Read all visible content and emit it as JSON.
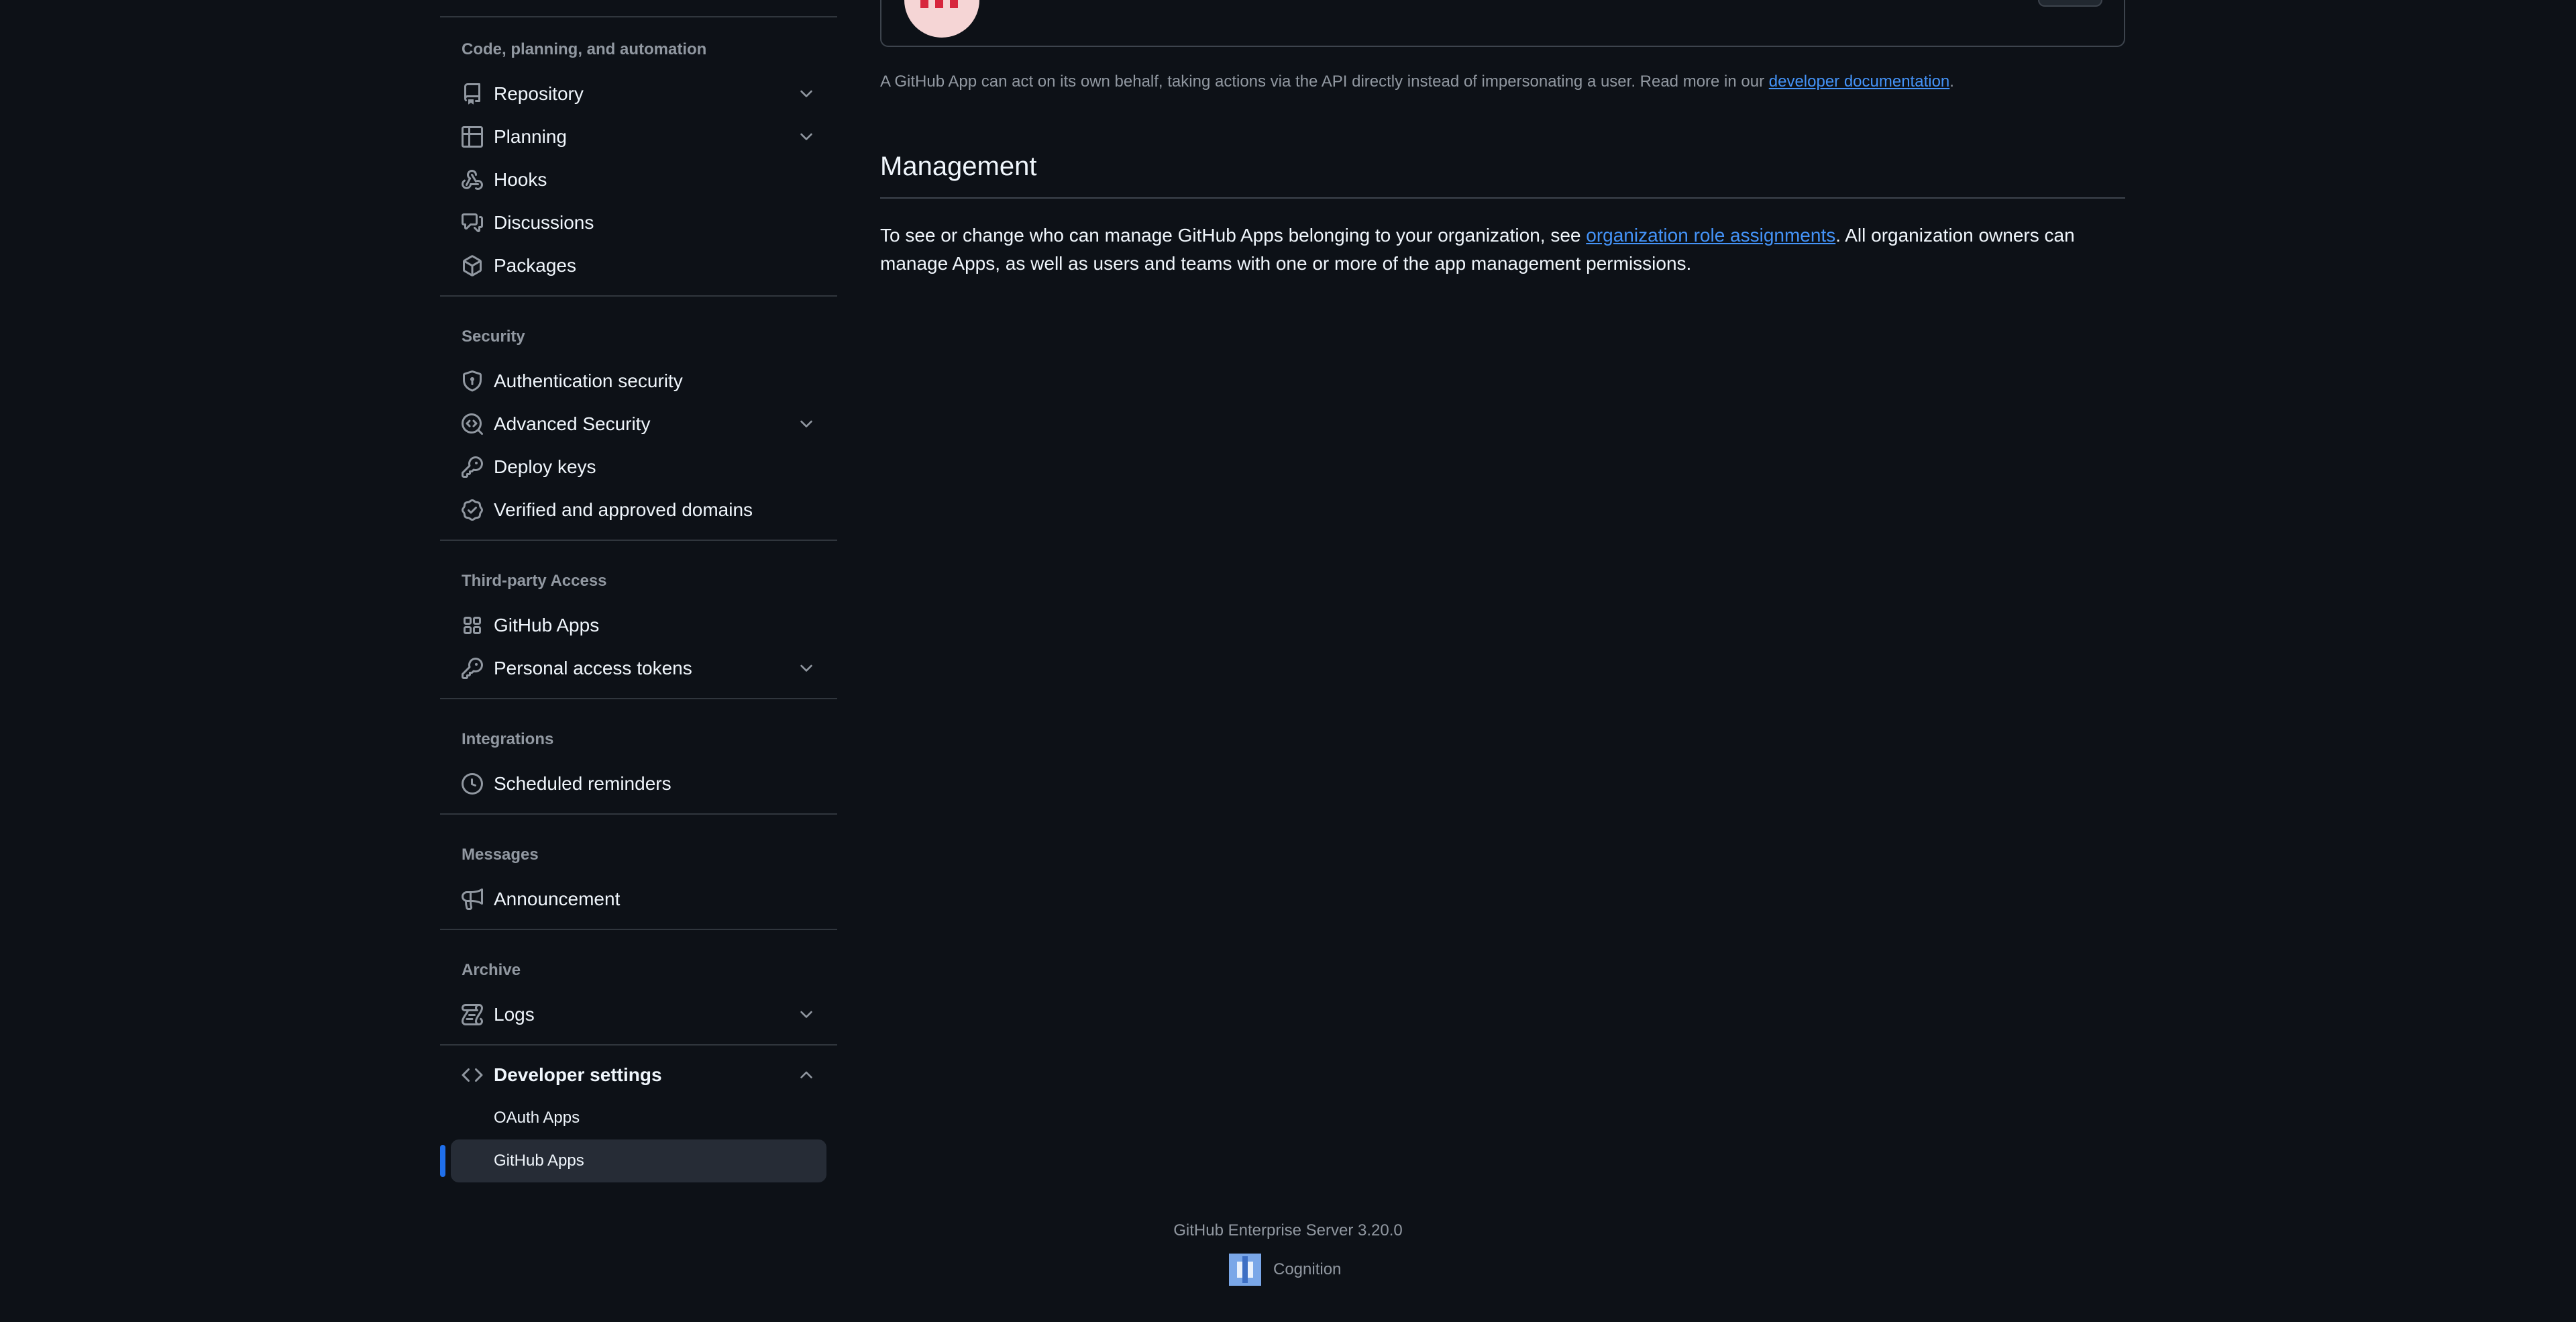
{
  "sidebar": {
    "sections": [
      {
        "heading": "Code, planning, and automation",
        "items": [
          {
            "label": "Repository",
            "icon": "repo-icon",
            "expandable": true
          },
          {
            "label": "Planning",
            "icon": "table-icon",
            "expandable": true
          },
          {
            "label": "Hooks",
            "icon": "webhook-icon",
            "expandable": false
          },
          {
            "label": "Discussions",
            "icon": "comment-discussion-icon",
            "expandable": false
          },
          {
            "label": "Packages",
            "icon": "package-icon",
            "expandable": false
          }
        ]
      },
      {
        "heading": "Security",
        "items": [
          {
            "label": "Authentication security",
            "icon": "shield-lock-icon",
            "expandable": false
          },
          {
            "label": "Advanced Security",
            "icon": "codescan-icon",
            "expandable": true
          },
          {
            "label": "Deploy keys",
            "icon": "key-icon",
            "expandable": false
          },
          {
            "label": "Verified and approved domains",
            "icon": "verified-icon",
            "expandable": false
          }
        ]
      },
      {
        "heading": "Third-party Access",
        "items": [
          {
            "label": "GitHub Apps",
            "icon": "apps-icon",
            "expandable": false
          },
          {
            "label": "Personal access tokens",
            "icon": "key-icon",
            "expandable": true
          }
        ]
      },
      {
        "heading": "Integrations",
        "items": [
          {
            "label": "Scheduled reminders",
            "icon": "clock-icon",
            "expandable": false
          }
        ]
      },
      {
        "heading": "Messages",
        "items": [
          {
            "label": "Announcement",
            "icon": "megaphone-icon",
            "expandable": false
          }
        ]
      },
      {
        "heading": "Archive",
        "items": [
          {
            "label": "Logs",
            "icon": "log-icon",
            "expandable": true
          }
        ]
      }
    ],
    "developer_settings": {
      "label": "Developer settings",
      "icon": "code-icon",
      "expanded": true,
      "sub_items": [
        {
          "label": "OAuth Apps",
          "active": false
        },
        {
          "label": "GitHub Apps",
          "active": true
        }
      ]
    }
  },
  "main": {
    "app_note_prefix": "A GitHub App can act on its own behalf, taking actions via the API directly instead of impersonating a user. Read more in our ",
    "app_note_link": "developer documentation",
    "app_note_suffix": ".",
    "management": {
      "title": "Management",
      "text_prefix": "To see or change who can manage GitHub Apps belonging to your organization, see ",
      "text_link": "organization role assignments",
      "text_suffix": ". All organization owners can manage Apps, as well as users and teams with one or more of the app management permissions."
    }
  },
  "footer": {
    "version": "GitHub Enterprise Server 3.20.0",
    "brand": "Cognition"
  },
  "colors": {
    "background": "#0d1117",
    "accent": "#1f6feb",
    "link": "#4493f8",
    "muted": "#9198a1"
  }
}
